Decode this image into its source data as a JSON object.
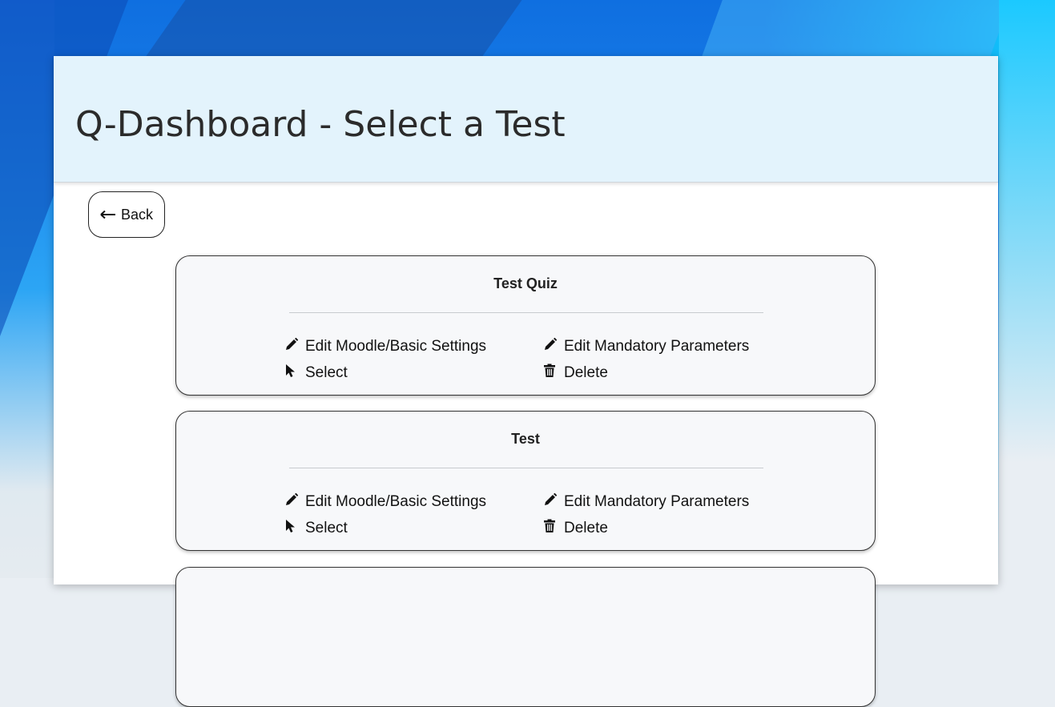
{
  "page": {
    "title": "Q-Dashboard - Select a Test"
  },
  "back_button": {
    "label": "Back"
  },
  "quizzes": [
    {
      "name": "Test Quiz",
      "actions": {
        "edit_basic": "Edit Moodle/Basic Settings",
        "edit_mandatory": "Edit Mandatory Parameters",
        "select": "Select",
        "delete": "Delete"
      }
    },
    {
      "name": "Test",
      "actions": {
        "edit_basic": "Edit Moodle/Basic Settings",
        "edit_mandatory": "Edit Mandatory Parameters",
        "select": "Select",
        "delete": "Delete"
      }
    }
  ],
  "icons": {
    "back": "arrow-left-icon",
    "edit": "pencil-icon",
    "select": "cursor-pointer-icon",
    "delete": "trash-icon"
  }
}
